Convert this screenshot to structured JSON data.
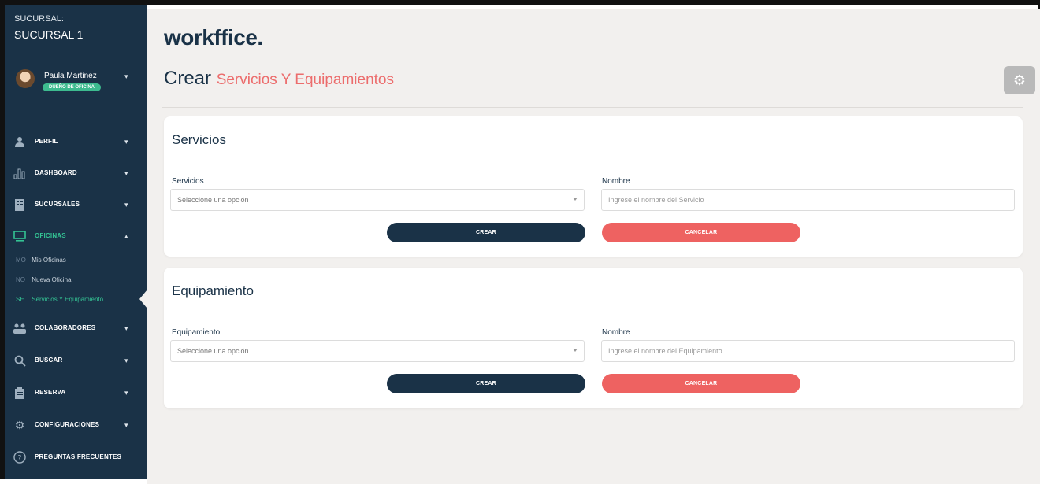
{
  "sidebar": {
    "branch_label": "SUCURSAL:",
    "branch_name": "SUCURSAL 1",
    "user": {
      "name": "Paula Martinez",
      "role": "DUEÑO DE OFICINA"
    },
    "items": [
      {
        "label": "PERFIL",
        "icon": "user-icon"
      },
      {
        "label": "DASHBOARD",
        "icon": "bar-chart-icon"
      },
      {
        "label": "SUCURSALES",
        "icon": "building-icon"
      },
      {
        "label": "OFICINAS",
        "icon": "monitor-icon"
      },
      {
        "label": "COLABORADORES",
        "icon": "people-icon"
      },
      {
        "label": "BUSCAR",
        "icon": "search-icon"
      },
      {
        "label": "RESERVA",
        "icon": "clipboard-icon"
      },
      {
        "label": "CONFIGURACIONES",
        "icon": "gear-icon"
      },
      {
        "label": "PREGUNTAS FRECUENTES",
        "icon": "question-icon"
      }
    ],
    "subitems": [
      {
        "abbr": "MO",
        "label": "Mis Oficinas"
      },
      {
        "abbr": "NO",
        "label": "Nueva Oficina"
      },
      {
        "abbr": "SE",
        "label": "Servicios Y Equipamiento"
      }
    ],
    "active_color": "#34c394"
  },
  "header": {
    "logo": "workffice.",
    "title_main": "Crear",
    "title_accent": "Servicios Y Equipamientos"
  },
  "servicios": {
    "title": "Servicios",
    "select_label": "Servicios",
    "select_value": "Seleccione una opción",
    "name_label": "Nombre",
    "name_placeholder": "Ingrese el nombre del Servicio",
    "create": "CREAR",
    "cancel": "CANCELAR"
  },
  "equipamiento": {
    "title": "Equipamiento",
    "select_label": "Equipamiento",
    "select_value": "Seleccione una opción",
    "name_label": "Nombre",
    "name_placeholder": "Ingrese el nombre del Equipamiento",
    "create": "CREAR",
    "cancel": "CANCELAR"
  },
  "colors": {
    "primary": "#1a3247",
    "accent": "#ec6c6c",
    "green": "#3dbb8f"
  }
}
